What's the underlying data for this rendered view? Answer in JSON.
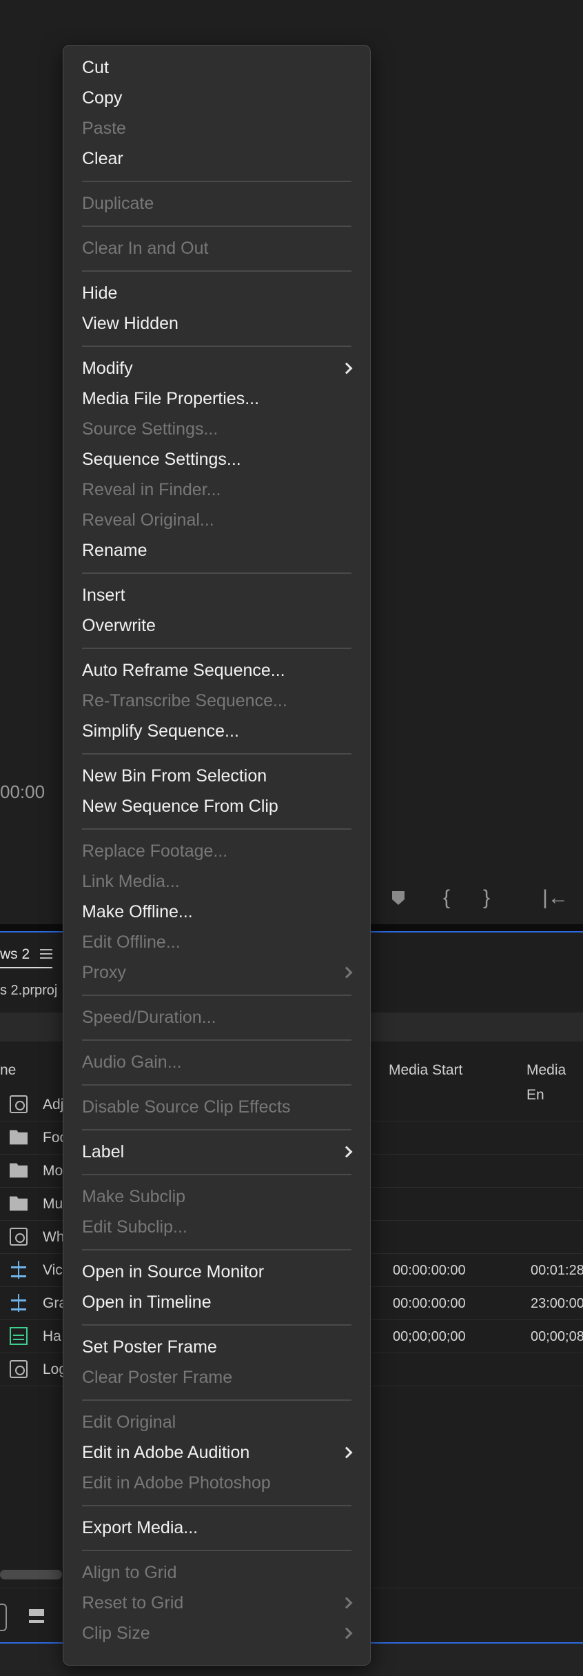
{
  "monitor": {
    "timecode": "00:00",
    "transport": {
      "in_glyph": "{",
      "out_glyph": "}",
      "goto_in_glyph": "|←"
    }
  },
  "project": {
    "tab_label": "ws 2",
    "path": "s 2.prproj",
    "columns": {
      "name": "ne",
      "media_start": "Media Start",
      "media_end": "Media En"
    },
    "rows": [
      {
        "icon": "clip-icon",
        "name": "Adj",
        "start": "",
        "end": ""
      },
      {
        "icon": "folder-icon",
        "name": "Foo",
        "start": "",
        "end": ""
      },
      {
        "icon": "folder-icon",
        "name": "Mo",
        "start": "",
        "end": ""
      },
      {
        "icon": "folder-icon",
        "name": "Mu",
        "start": "",
        "end": ""
      },
      {
        "icon": "clip-icon",
        "name": "Wh",
        "start": "",
        "end": ""
      },
      {
        "icon": "sequence-icon",
        "name": "Vic",
        "start": "00:00:00:00",
        "end": "00:01:28"
      },
      {
        "icon": "sequence-icon",
        "name": "Gra",
        "start": "00:00:00:00",
        "end": "23:00:00"
      },
      {
        "icon": "audio-icon",
        "name": "Ha",
        "start": "00;00;00;00",
        "end": "00;00;08"
      },
      {
        "icon": "clip-icon",
        "name": "Log",
        "start": "",
        "end": ""
      }
    ]
  },
  "menu": {
    "groups": [
      [
        {
          "label": "Cut",
          "enabled": true
        },
        {
          "label": "Copy",
          "enabled": true
        },
        {
          "label": "Paste",
          "enabled": false
        },
        {
          "label": "Clear",
          "enabled": true
        }
      ],
      [
        {
          "label": "Duplicate",
          "enabled": false
        }
      ],
      [
        {
          "label": "Clear In and Out",
          "enabled": false
        }
      ],
      [
        {
          "label": "Hide",
          "enabled": true
        },
        {
          "label": "View Hidden",
          "enabled": true
        }
      ],
      [
        {
          "label": "Modify",
          "enabled": true,
          "submenu": true
        },
        {
          "label": "Media File Properties...",
          "enabled": true
        },
        {
          "label": "Source Settings...",
          "enabled": false
        },
        {
          "label": "Sequence Settings...",
          "enabled": true
        },
        {
          "label": "Reveal in Finder...",
          "enabled": false
        },
        {
          "label": "Reveal Original...",
          "enabled": false
        },
        {
          "label": "Rename",
          "enabled": true
        }
      ],
      [
        {
          "label": "Insert",
          "enabled": true
        },
        {
          "label": "Overwrite",
          "enabled": true
        }
      ],
      [
        {
          "label": "Auto Reframe Sequence...",
          "enabled": true
        },
        {
          "label": "Re-Transcribe Sequence...",
          "enabled": false
        },
        {
          "label": "Simplify Sequence...",
          "enabled": true
        }
      ],
      [
        {
          "label": "New Bin From Selection",
          "enabled": true
        },
        {
          "label": "New Sequence From Clip",
          "enabled": true
        }
      ],
      [
        {
          "label": "Replace Footage...",
          "enabled": false
        },
        {
          "label": "Link Media...",
          "enabled": false
        },
        {
          "label": "Make Offline...",
          "enabled": true
        },
        {
          "label": "Edit Offline...",
          "enabled": false
        },
        {
          "label": "Proxy",
          "enabled": false,
          "submenu": true
        }
      ],
      [
        {
          "label": "Speed/Duration...",
          "enabled": false
        }
      ],
      [
        {
          "label": "Audio Gain...",
          "enabled": false
        }
      ],
      [
        {
          "label": "Disable Source Clip Effects",
          "enabled": false
        }
      ],
      [
        {
          "label": "Label",
          "enabled": true,
          "submenu": true
        }
      ],
      [
        {
          "label": "Make Subclip",
          "enabled": false
        },
        {
          "label": "Edit Subclip...",
          "enabled": false
        }
      ],
      [
        {
          "label": "Open in Source Monitor",
          "enabled": true
        },
        {
          "label": "Open in Timeline",
          "enabled": true
        }
      ],
      [
        {
          "label": "Set Poster Frame",
          "enabled": true
        },
        {
          "label": "Clear Poster Frame",
          "enabled": false
        }
      ],
      [
        {
          "label": "Edit Original",
          "enabled": false
        },
        {
          "label": "Edit in Adobe Audition",
          "enabled": true,
          "submenu": true
        },
        {
          "label": "Edit in Adobe Photoshop",
          "enabled": false
        }
      ],
      [
        {
          "label": "Export Media...",
          "enabled": true
        }
      ],
      [
        {
          "label": "Align to Grid",
          "enabled": false
        },
        {
          "label": "Reset to Grid",
          "enabled": false,
          "submenu": true
        },
        {
          "label": "Clip Size",
          "enabled": false,
          "submenu": true
        }
      ]
    ]
  }
}
